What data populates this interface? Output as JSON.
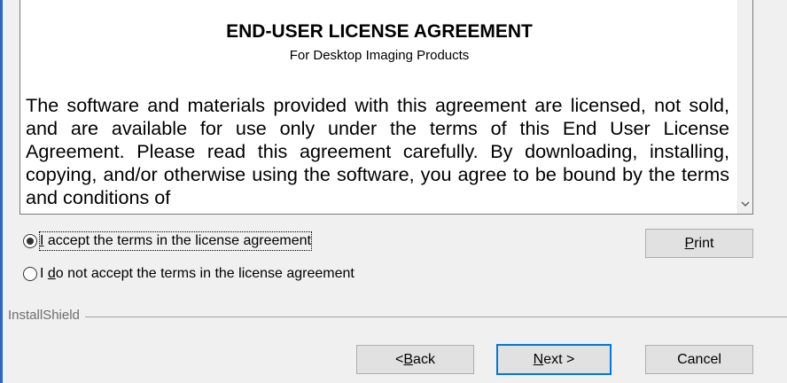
{
  "license": {
    "title": "END-USER LICENSE AGREEMENT",
    "subtitle": "For Desktop Imaging Products",
    "body": "The software and materials provided with this agreement are licensed, not sold, and are available for use only under the terms of this End User License Agreement. Please read this agreement carefully. By downloading, installing, copying, and/or otherwise using the software, you agree to be bound by the terms and conditions of"
  },
  "options": {
    "accept": {
      "prefix": "I",
      "suffix": " accept the terms in the license agreement",
      "checked": true
    },
    "decline": {
      "prefix": "I ",
      "hotkey": "d",
      "suffix": "o not accept the terms in the license agreement",
      "checked": false
    }
  },
  "buttons": {
    "print": {
      "hotkey": "P",
      "rest": "rint"
    },
    "back": {
      "prefix": "< ",
      "hotkey": "B",
      "rest": "ack"
    },
    "next": {
      "hotkey": "N",
      "rest": "ext >"
    },
    "cancel": "Cancel"
  },
  "footer": {
    "brand": "InstallShield"
  },
  "colors": {
    "accent": "#0078d7",
    "window_border": "#2b65c8",
    "background": "#f0f0f0"
  },
  "icons": {
    "scroll_down": "chevron-down-icon"
  }
}
